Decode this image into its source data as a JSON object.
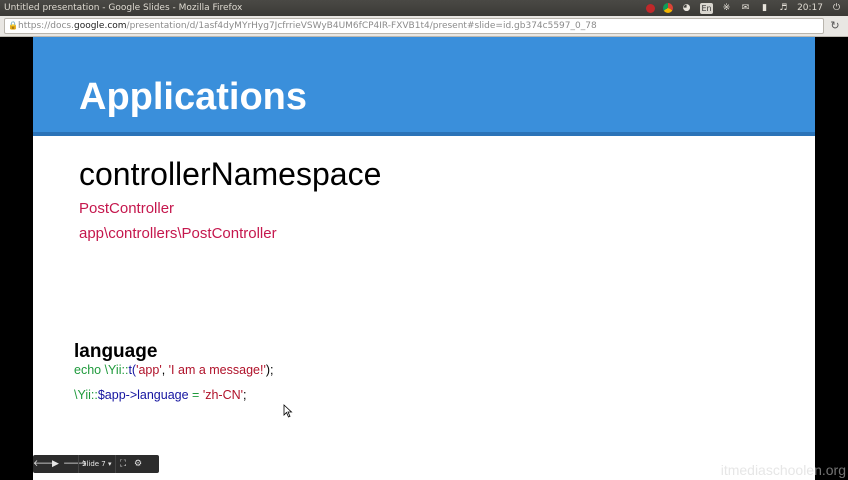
{
  "window": {
    "title": "Untitled presentation - Google Slides - Mozilla Firefox",
    "tray": {
      "keyboard_layout": "En",
      "clock": "20:17"
    },
    "tray_icons": [
      "record-icon",
      "chrome-icon",
      "wifi-icon",
      "keyboard-icon",
      "bluetooth-icon",
      "mail-icon",
      "battery-icon",
      "volume-icon",
      "clock-text",
      "power-icon"
    ]
  },
  "browser": {
    "url_prefix": "https://docs.",
    "url_domain": "google.com",
    "url_rest": "/presentation/d/1asf4dyMYrHyg7JcfrrieVSWyB4UM6fCP4IR-FXVB1t4/present#slide=id.gb374c5597_0_78"
  },
  "slide": {
    "title": "Applications",
    "subtitle": "controllerNamespace",
    "links": [
      "PostController",
      "app\\controllers\\PostController"
    ],
    "section": "language",
    "code_line1": {
      "p1": "echo \\Yii::",
      "p2": "t(",
      "p3": "'app'",
      "p4": ", ",
      "p5": "'I am a message!'",
      "p6": ");"
    },
    "code_line2": {
      "p1": "\\Yii::",
      "p2": "$app->language",
      "p3": " = ",
      "p4": "'zh-CN'",
      "p5": ";"
    }
  },
  "controls": {
    "slide_label": "Slide 7"
  },
  "watermark": "itmediaschoolen.org",
  "colors": {
    "header_blue": "#3a8fdb",
    "link_red": "#c5174d",
    "code_green": "#1f9a3c",
    "code_blue": "#1414a0",
    "code_red": "#b0122a"
  }
}
